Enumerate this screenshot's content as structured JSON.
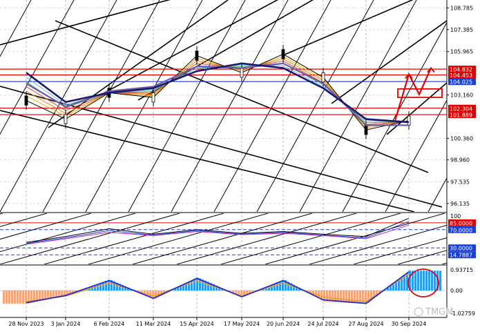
{
  "chart_data": [
    {
      "type": "line",
      "panel": "price",
      "title": "",
      "y_ticks": [
        "108.785",
        "107.385",
        "105.965",
        "104.832",
        "104.453",
        "104.025",
        "103.160",
        "102.304",
        "101.889",
        "100.360",
        "98.960",
        "97.535",
        "96.135"
      ],
      "key_levels": [
        {
          "label": "104.832",
          "value": 104.832,
          "color": "#e00000"
        },
        {
          "label": "104.453",
          "value": 104.453,
          "color": "#e00000"
        },
        {
          "label": "104.025",
          "value": 104.025,
          "color": "#1a3fd8"
        },
        {
          "label": "102.304",
          "value": 102.304,
          "color": "#e00000"
        },
        {
          "label": "101.889",
          "value": 101.889,
          "color": "#e00000"
        }
      ],
      "ylim": [
        95.6,
        109.3
      ],
      "x": [
        "28 Nov 2023",
        "3 Jan 2024",
        "6 Feb 2024",
        "11 Mar 2024",
        "15 Apr 2024",
        "17 May 2024",
        "20 Jun 2024",
        "24 Jul 2024",
        "27 Aug 2024",
        "30 Sep 2024"
      ],
      "close": [
        102.8,
        101.6,
        103.3,
        103.0,
        105.7,
        104.6,
        105.8,
        104.3,
        100.9,
        101.5
      ],
      "ma_long": [
        104.6,
        102.7,
        103.3,
        103.6,
        104.7,
        105.2,
        104.9,
        103.6,
        101.6,
        101.4
      ],
      "ma_short": [
        103.9,
        102.4,
        103.4,
        103.7,
        105.0,
        104.9,
        105.2,
        103.9,
        101.2,
        101.2
      ],
      "projection": [
        101.5,
        104.5,
        103.2,
        104.9
      ],
      "projection_color": "#e00000",
      "fan_colors": [
        "#e8b800",
        "#f07d28",
        "#d14a3a",
        "#4aa85a",
        "#5dbbd6"
      ]
    },
    {
      "type": "line",
      "panel": "oscillator",
      "y_ticks": [
        "100",
        "85.0000",
        "70.0000",
        "30.0000",
        "14.7887"
      ],
      "levels": [
        {
          "label": "85.0000",
          "value": 85,
          "color": "#e00000"
        },
        {
          "label": "70.0000",
          "value": 70,
          "color": "#1a3fd8"
        },
        {
          "label": "30.0000",
          "value": 30,
          "color": "#1a3fd8"
        },
        {
          "label": "14.7887",
          "value": 14.7887,
          "color": "#1a3fd8"
        }
      ],
      "ylim": [
        0,
        100
      ],
      "series": [
        {
          "values": [
            42,
            55,
            72,
            60,
            70,
            62,
            66,
            60,
            55,
            95
          ],
          "color": "#000000"
        },
        {
          "values": [
            40,
            52,
            68,
            58,
            68,
            60,
            64,
            58,
            52,
            88
          ],
          "color": "#1a3fd8"
        },
        {
          "values": [
            38,
            50,
            64,
            57,
            66,
            59,
            62,
            57,
            50,
            80
          ],
          "color": "#c020c0"
        }
      ]
    },
    {
      "type": "bar",
      "panel": "macd",
      "y_ticks": [
        "0.93715",
        "0.00",
        "-1.02759"
      ],
      "ylim": [
        -1.02759,
        0.93715
      ],
      "histogram": [
        -0.6,
        -0.2,
        0.5,
        -0.4,
        0.6,
        -0.3,
        0.5,
        -0.5,
        -0.6,
        0.9
      ],
      "signal": [
        -0.5,
        -0.25,
        0.35,
        -0.25,
        0.45,
        -0.25,
        0.35,
        -0.3,
        -0.5,
        0.75
      ],
      "macd": [
        -0.55,
        -0.22,
        0.45,
        -0.35,
        0.55,
        -0.28,
        0.45,
        -0.42,
        -0.58,
        0.85
      ]
    }
  ],
  "x_labels": [
    "28 Nov 2023",
    "3 Jan 2024",
    "6 Feb 2024",
    "11 Mar 2024",
    "15 Apr 2024",
    "17 May 2024",
    "20 Jun 2024",
    "24 Jul 2024",
    "27 Aug 2024",
    "30 Sep 2024"
  ],
  "watermark": "TMGM",
  "colors": {
    "level_red": "#e00000",
    "level_blue": "#1a3fd8",
    "hist_pos": "#2f9be8",
    "hist_neg": "#f3a57c",
    "signal": "#f09a26",
    "macd": "#1a2fd0"
  }
}
